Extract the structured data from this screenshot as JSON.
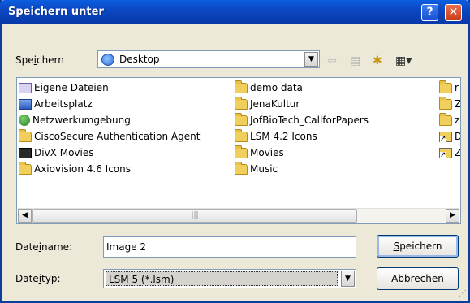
{
  "window": {
    "title": "Speichern unter",
    "help_icon": "question-icon",
    "close_icon": "close-icon"
  },
  "toolbar": {
    "savein_label_pre": "Spe",
    "savein_label_key": "i",
    "savein_label_post": "chern",
    "location_value": "Desktop",
    "back_icon": "back-arrow-icon",
    "up_icon": "up-folder-icon",
    "newfolder_icon": "new-folder-icon",
    "view_icon": "view-menu-icon"
  },
  "files": {
    "col1": [
      "Eigene Dateien",
      "Arbeitsplatz",
      "Netzwerkumgebung",
      "CiscoSecure Authentication Agent",
      "DivX Movies",
      "Axiovision 4.6 Icons"
    ],
    "col2": [
      "demo data",
      "JenaKultur",
      "JofBioTech_CallforPapers",
      "LSM 4.2 Icons",
      "Movies",
      "Music"
    ],
    "col3": [
      "r",
      "Z",
      "z",
      "D",
      "Z"
    ]
  },
  "filename": {
    "label_pre": "Date",
    "label_key": "i",
    "label_post": "name:",
    "value": "Image 2"
  },
  "filetype": {
    "label_pre": "Date",
    "label_key": "i",
    "label_post": "typ:",
    "value": "LSM 5 (*.lsm)"
  },
  "buttons": {
    "save_key": "S",
    "save_rest": "peichern",
    "cancel": "Abbrechen"
  }
}
